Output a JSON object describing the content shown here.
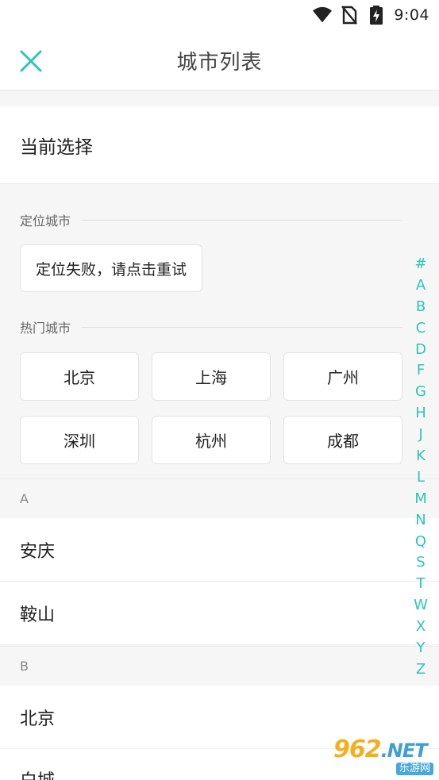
{
  "status_bar": {
    "time": "9:04"
  },
  "header": {
    "title": "城市列表"
  },
  "current": {
    "label": "当前选择"
  },
  "locate": {
    "section_label": "定位城市",
    "button_label": "定位失败，请点击重试"
  },
  "hot": {
    "section_label": "热门城市",
    "cities": [
      "北京",
      "上海",
      "广州",
      "深圳",
      "杭州",
      "成都"
    ]
  },
  "groups": [
    {
      "letter": "A",
      "cities": [
        "安庆",
        "鞍山"
      ]
    },
    {
      "letter": "B",
      "cities": [
        "北京",
        "白城"
      ]
    }
  ],
  "index_letters": [
    "#",
    "A",
    "B",
    "C",
    "D",
    "F",
    "G",
    "H",
    "J",
    "K",
    "L",
    "M",
    "N",
    "Q",
    "S",
    "T",
    "W",
    "X",
    "Y",
    "Z"
  ],
  "watermark": {
    "main": "962",
    "net": ".NET",
    "sub": "乐游网"
  },
  "colors": {
    "accent": "#2cc6b6",
    "background": "#f6f6f6"
  }
}
